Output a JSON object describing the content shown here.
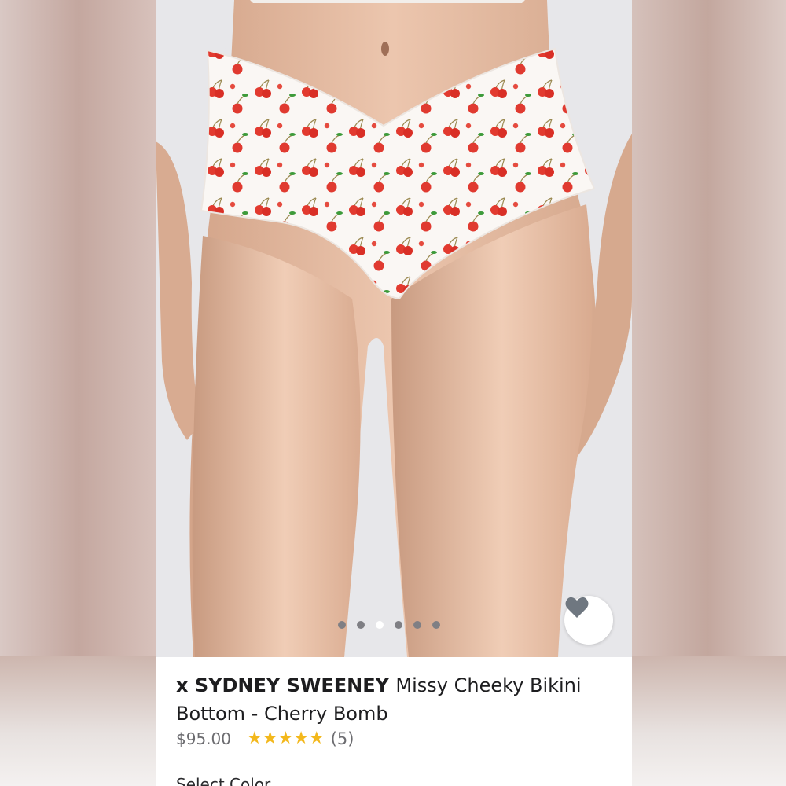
{
  "product": {
    "brand": "x SYDNEY SWEENEY",
    "name": "Missy Cheeky Bikini Bottom - Cherry Bomb",
    "price": "$95.00",
    "rating": 5,
    "rating_max": 5,
    "review_count": "(5)"
  },
  "carousel": {
    "dot_count": 6,
    "active_index": 2
  },
  "favorite": {
    "icon": "heart-icon"
  },
  "options": {
    "select_label": "Select Color"
  },
  "colors": {
    "star": "#f3b81c",
    "text_primary": "#1d1d1f",
    "text_secondary": "#6c6c70",
    "heart": "#6f7780"
  }
}
